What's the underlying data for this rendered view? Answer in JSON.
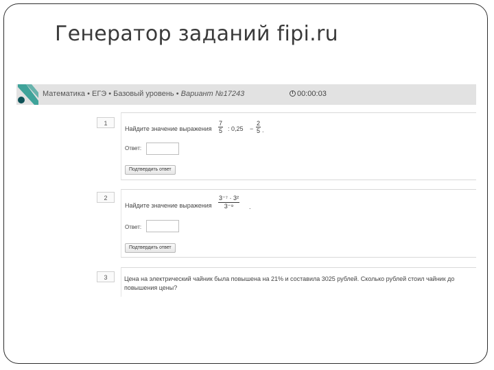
{
  "slide": {
    "title": "Генератор заданий fipi.ru"
  },
  "header": {
    "breadcrumb_subject": "Математика",
    "breadcrumb_exam": "ЕГЭ",
    "breadcrumb_level": "Базовый уровень",
    "breadcrumb_variant": "Вариант №17243",
    "separator": "•",
    "timer": "00:00:03",
    "logo_color": "#3fa39a",
    "logo_dot_color": "#0e5257"
  },
  "tasks": [
    {
      "number": "1",
      "prompt": "Найдите значение выражения",
      "expr_a_num": "7",
      "expr_a_den": "5",
      "expr_mid": ": 0,25",
      "expr_dash": "−",
      "expr_b_num": "2",
      "expr_b_den": "5",
      "expr_end": ".",
      "answer_label": "Ответ:",
      "answer_value": "",
      "submit_label": "Подтвердить ответ"
    },
    {
      "number": "2",
      "prompt": "Найдите значение выражения",
      "expr_num": "3⁻⁷ · 3²",
      "expr_den": "3⁻⁹",
      "expr_end": ".",
      "answer_label": "Ответ:",
      "answer_value": "",
      "submit_label": "Подтвердить ответ"
    },
    {
      "number": "3",
      "text": "Цена на электрический чайник была повышена на 21% и составила 3025 рублей. Сколько рублей стоил чайник до повышения цены?"
    }
  ]
}
